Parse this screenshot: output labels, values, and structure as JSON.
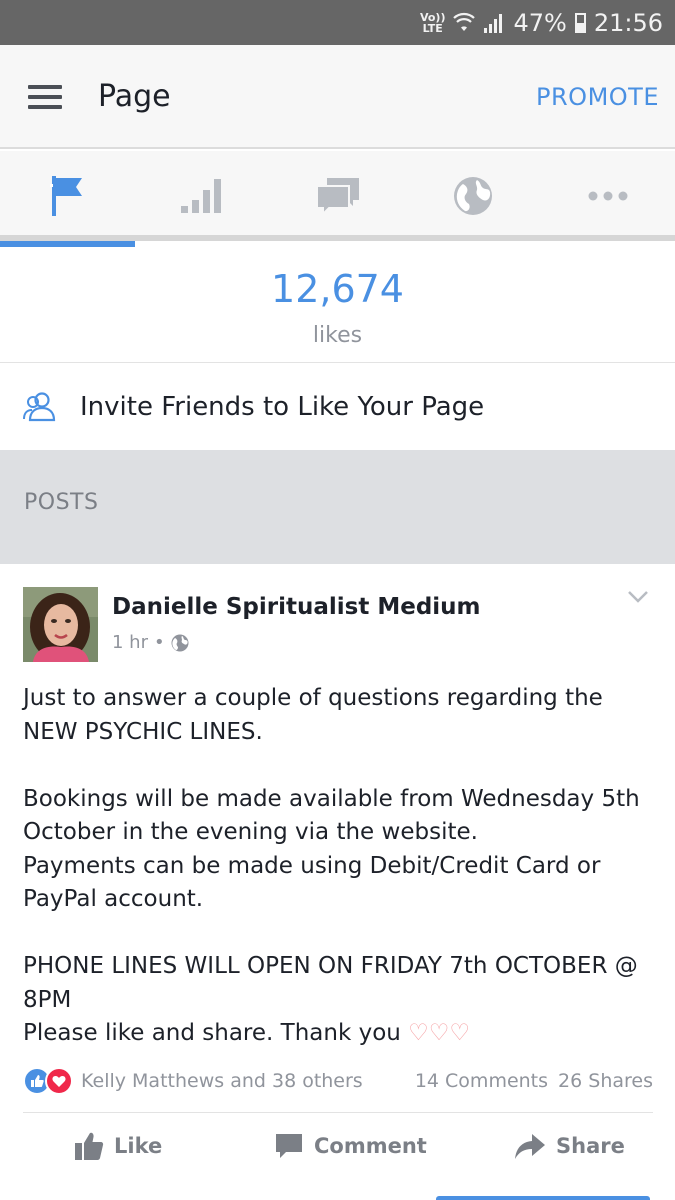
{
  "status_bar": {
    "network_label": "Vo)) LTE",
    "battery": "47%",
    "time": "21:56"
  },
  "app_bar": {
    "title": "Page",
    "promote_label": "PROMOTE"
  },
  "tabs": [
    {
      "icon": "flag-icon",
      "active": true
    },
    {
      "icon": "insights-bars-icon",
      "active": false
    },
    {
      "icon": "messages-icon",
      "active": false
    },
    {
      "icon": "globe-icon",
      "active": false
    },
    {
      "icon": "more-dots-icon",
      "active": false
    }
  ],
  "likes": {
    "count": "12,674",
    "label": "likes"
  },
  "invite": {
    "label": "Invite Friends to Like Your Page"
  },
  "posts_header": {
    "label": "POSTS"
  },
  "post": {
    "author": "Danielle Spiritualist Medium",
    "time": "1 hr",
    "separator": "•",
    "paragraphs": [
      "Just to answer a couple of questions regarding the NEW PSYCHIC LINES.",
      "Bookings will be made available from Wednesday 5th October in the evening via the website.",
      "Payments can be made using Debit/Credit Card or PayPal account.",
      "PHONE LINES WILL OPEN ON FRIDAY 7th OCTOBER @ 8PM",
      "Please like and share. Thank you"
    ],
    "hearts": "♡♡♡",
    "reactions_text": "Kelly Matthews and 38 others",
    "comments": "14 Comments",
    "shares": "26 Shares"
  },
  "actions": {
    "like": "Like",
    "comment": "Comment",
    "share": "Share"
  },
  "colors": {
    "accent": "#4a90e2",
    "status_bar": "#666666",
    "love": "#f0284a"
  }
}
